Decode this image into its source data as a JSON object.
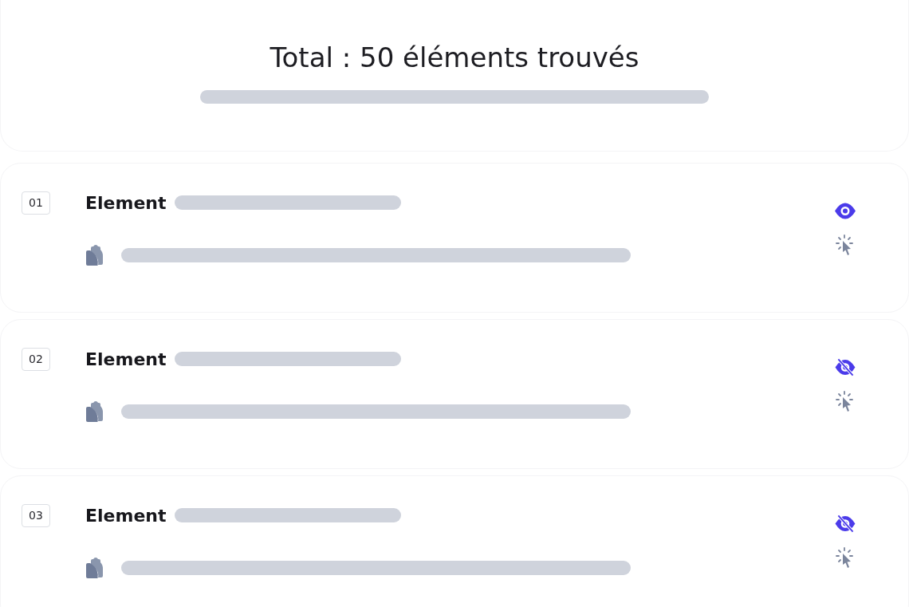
{
  "header": {
    "title": "Total : 50 éléments trouvés"
  },
  "items": [
    {
      "index": "01",
      "label": "Element",
      "visible": true
    },
    {
      "index": "02",
      "label": "Element",
      "visible": false
    },
    {
      "index": "03",
      "label": "Element",
      "visible": false
    }
  ]
}
